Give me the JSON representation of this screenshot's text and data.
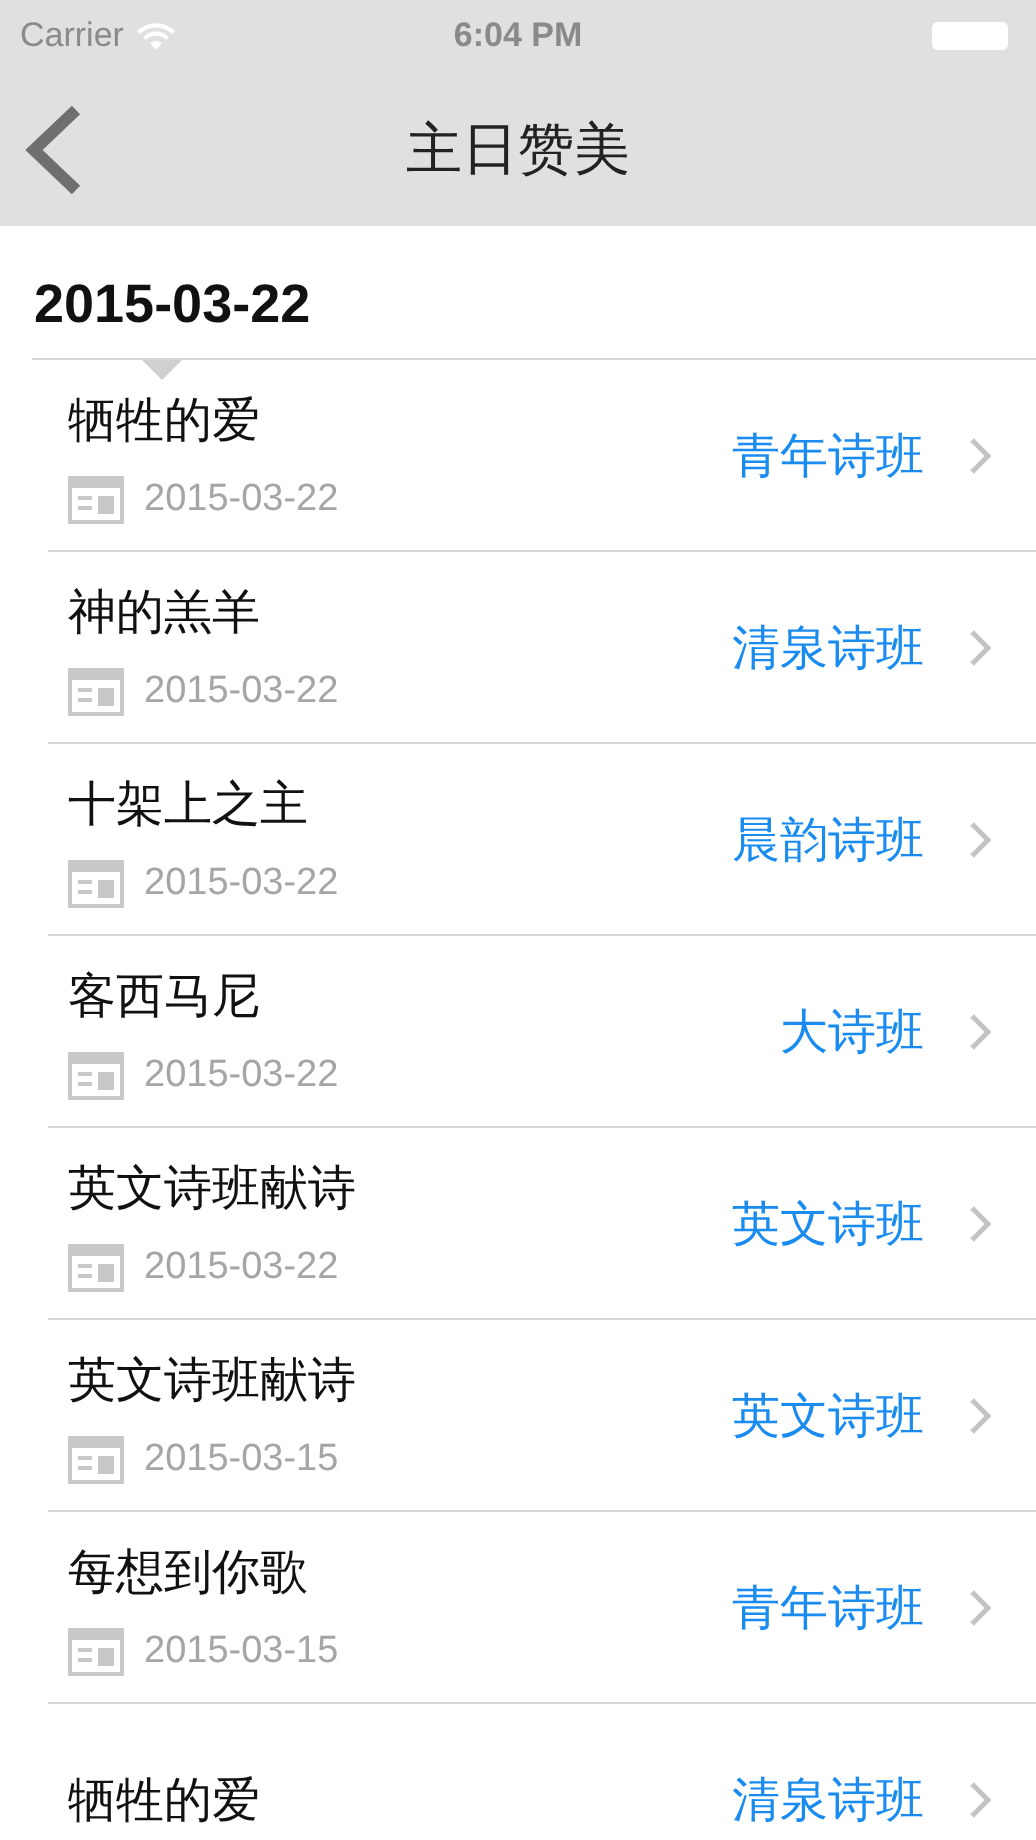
{
  "status_bar": {
    "carrier": "Carrier",
    "time": "6:04 PM"
  },
  "nav_bar": {
    "title": "主日赞美"
  },
  "section": {
    "date": "2015-03-22"
  },
  "items": [
    {
      "title": "牺牲的爱",
      "date": "2015-03-22",
      "group": "青年诗班"
    },
    {
      "title": "神的羔羊",
      "date": "2015-03-22",
      "group": "清泉诗班"
    },
    {
      "title": "十架上之主",
      "date": "2015-03-22",
      "group": "晨韵诗班"
    },
    {
      "title": "客西马尼",
      "date": "2015-03-22",
      "group": "大诗班"
    },
    {
      "title": "英文诗班献诗",
      "date": "2015-03-22",
      "group": "英文诗班"
    },
    {
      "title": "英文诗班献诗",
      "date": "2015-03-15",
      "group": "英文诗班"
    },
    {
      "title": "每想到你歌",
      "date": "2015-03-15",
      "group": "青年诗班"
    },
    {
      "title": "牺牲的爱",
      "group": "清泉诗班"
    }
  ]
}
